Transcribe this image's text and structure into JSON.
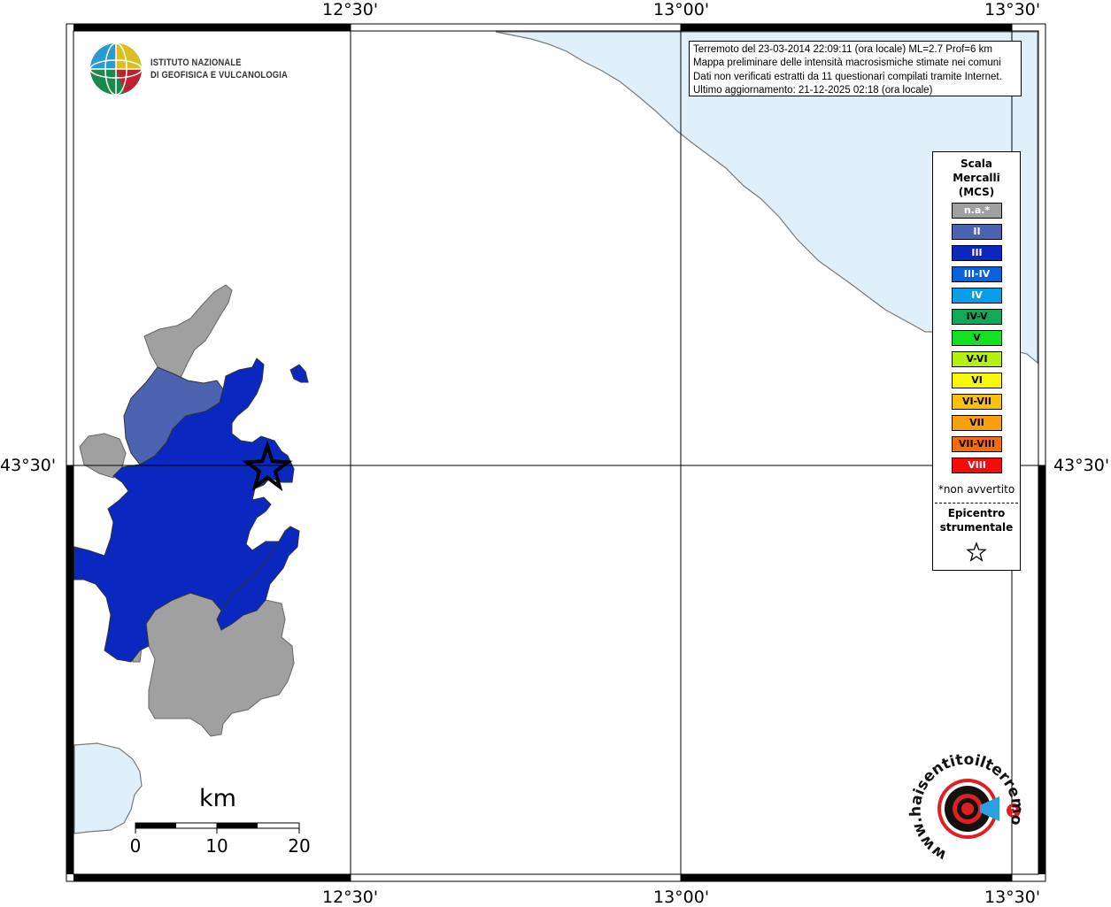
{
  "map": {
    "lon_labels": [
      "12°30'",
      "13°00'",
      "13°30'"
    ],
    "lat_label": "43°30'",
    "graticule": {
      "longitudes": [
        "12°30'",
        "13°00'",
        "13°30'"
      ],
      "latitudes": [
        "43°30'"
      ]
    }
  },
  "info": {
    "line1": "Terremoto del 23-03-2014 22:09:11 (ora locale) ML=2.7 Prof=6 km",
    "line2": "Mappa preliminare delle intensità macrosismiche stimate nei comuni",
    "line3": "Dati non verificati estratti da 11 questionari compilati tramite Internet.",
    "line4": "Ultimo aggiornamento: 21-12-2025 02:18 (ora locale)"
  },
  "logo": {
    "line1": "ISTITUTO NAZIONALE",
    "line2": "DI GEOFISICA E VULCANOLOGIA",
    "icon": "ingv-globe-logo"
  },
  "legend": {
    "title": [
      "Scala",
      "Mercalli",
      "(MCS)"
    ],
    "items": [
      {
        "label": "n.a.*",
        "color": "#a0a0a0",
        "text": "light"
      },
      {
        "label": "II",
        "color": "#4c63b0",
        "text": "light"
      },
      {
        "label": "III",
        "color": "#0a28c0",
        "text": "light"
      },
      {
        "label": "III-IV",
        "color": "#0a62d8",
        "text": "light"
      },
      {
        "label": "IV",
        "color": "#0a9ee8",
        "text": "light"
      },
      {
        "label": "IV-V",
        "color": "#12a85a",
        "text": "dark"
      },
      {
        "label": "V",
        "color": "#12e020",
        "text": "dark"
      },
      {
        "label": "V-VI",
        "color": "#b4f010",
        "text": "dark"
      },
      {
        "label": "VI",
        "color": "#f8f808",
        "text": "dark"
      },
      {
        "label": "VI-VII",
        "color": "#f8c010",
        "text": "dark"
      },
      {
        "label": "VII",
        "color": "#f8a010",
        "text": "dark"
      },
      {
        "label": "VII-VIII",
        "color": "#f86a10",
        "text": "dark"
      },
      {
        "label": "VIII",
        "color": "#f80a0a",
        "text": "light"
      }
    ],
    "note": "*non avvertito",
    "epicenter": [
      "Epicentro",
      "strumentale"
    ]
  },
  "scalebar": {
    "unit": "km",
    "ticks": [
      "0",
      "10",
      "20"
    ]
  },
  "watermark": {
    "text": "www.haisentitoilterremoto.it",
    "icon": "haisentito-logo"
  },
  "colors": {
    "sea": "#dff0fb",
    "coast": "#7a7a7a",
    "intensity_na": "#a0a0a0",
    "intensity_ii": "#4c63b0",
    "intensity_iii": "#0a28c0"
  }
}
